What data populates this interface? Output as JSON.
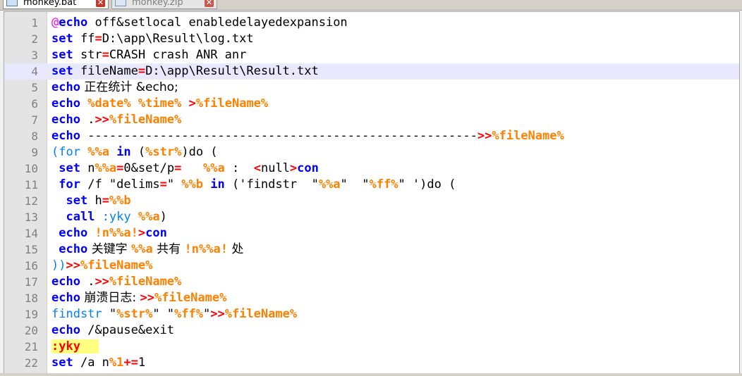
{
  "tabs": [
    {
      "label": "monkey.bat",
      "active": true
    },
    {
      "label": "monkey.zip",
      "active": false
    }
  ],
  "editor": {
    "current_line": 4,
    "lines": [
      {
        "n": "1",
        "tokens": [
          {
            "t": "@",
            "c": "at"
          },
          {
            "t": "echo",
            "c": "kw"
          },
          {
            "t": " off&setlocal enabledelayedexpansion",
            "c": "txt"
          }
        ]
      },
      {
        "n": "2",
        "tokens": [
          {
            "t": "set",
            "c": "kw"
          },
          {
            "t": " ff",
            "c": "txt"
          },
          {
            "t": "=",
            "c": "op"
          },
          {
            "t": "D:\\app\\Result\\log.txt",
            "c": "txt"
          }
        ]
      },
      {
        "n": "3",
        "tokens": [
          {
            "t": "set",
            "c": "kw"
          },
          {
            "t": " str",
            "c": "txt"
          },
          {
            "t": "=",
            "c": "op"
          },
          {
            "t": "CRASH crash ANR anr",
            "c": "txt"
          }
        ]
      },
      {
        "n": "4",
        "tokens": [
          {
            "t": "set",
            "c": "kw"
          },
          {
            "t": " fileName",
            "c": "txt"
          },
          {
            "t": "=",
            "c": "op"
          },
          {
            "t": "D:\\app\\Result\\Result.txt",
            "c": "txt"
          }
        ]
      },
      {
        "n": "5",
        "tokens": [
          {
            "t": "echo",
            "c": "kw"
          },
          {
            "t": " 正在统计 &echo;",
            "c": "txt"
          }
        ]
      },
      {
        "n": "6",
        "tokens": [
          {
            "t": "echo",
            "c": "kw"
          },
          {
            "t": " ",
            "c": "txt"
          },
          {
            "t": "%date%",
            "c": "var"
          },
          {
            "t": " ",
            "c": "txt"
          },
          {
            "t": "%time%",
            "c": "var"
          },
          {
            "t": " ",
            "c": "txt"
          },
          {
            "t": ">",
            "c": "op"
          },
          {
            "t": "%fileName%",
            "c": "var"
          }
        ]
      },
      {
        "n": "7",
        "tokens": [
          {
            "t": "echo",
            "c": "kw"
          },
          {
            "t": " .",
            "c": "txt"
          },
          {
            "t": ">>",
            "c": "op"
          },
          {
            "t": "%fileName%",
            "c": "var"
          }
        ]
      },
      {
        "n": "8",
        "tokens": [
          {
            "t": "echo",
            "c": "kw"
          },
          {
            "t": " ------------------------------------------------------",
            "c": "txt"
          },
          {
            "t": ">>",
            "c": "op"
          },
          {
            "t": "%fileName%",
            "c": "var"
          }
        ]
      },
      {
        "n": "9",
        "tokens": [
          {
            "t": "(",
            "c": "ext"
          },
          {
            "t": "for",
            "c": "ext"
          },
          {
            "t": " ",
            "c": "txt"
          },
          {
            "t": "%%a",
            "c": "var"
          },
          {
            "t": " ",
            "c": "txt"
          },
          {
            "t": "in",
            "c": "kw"
          },
          {
            "t": " (",
            "c": "txt"
          },
          {
            "t": "%str%",
            "c": "var"
          },
          {
            "t": ")do (",
            "c": "txt"
          }
        ]
      },
      {
        "n": "10",
        "tokens": [
          {
            "t": " ",
            "c": "txt"
          },
          {
            "t": "set",
            "c": "kw"
          },
          {
            "t": " n",
            "c": "txt"
          },
          {
            "t": "%%a",
            "c": "var"
          },
          {
            "t": "=",
            "c": "op"
          },
          {
            "t": "0&set/p",
            "c": "txt"
          },
          {
            "t": "=",
            "c": "op"
          },
          {
            "t": "   ",
            "c": "txt"
          },
          {
            "t": "%%a",
            "c": "var"
          },
          {
            "t": " :  ",
            "c": "txt"
          },
          {
            "t": "<",
            "c": "op"
          },
          {
            "t": "null",
            "c": "txt"
          },
          {
            "t": ">",
            "c": "op"
          },
          {
            "t": "con",
            "c": "kw"
          }
        ]
      },
      {
        "n": "11",
        "tokens": [
          {
            "t": " ",
            "c": "txt"
          },
          {
            "t": "for",
            "c": "kw"
          },
          {
            "t": " /f \"delims",
            "c": "txt"
          },
          {
            "t": "=",
            "c": "op"
          },
          {
            "t": "\" ",
            "c": "txt"
          },
          {
            "t": "%%b",
            "c": "var"
          },
          {
            "t": " ",
            "c": "txt"
          },
          {
            "t": "in",
            "c": "kw"
          },
          {
            "t": " ('findstr  \"",
            "c": "txt"
          },
          {
            "t": "%%a",
            "c": "var"
          },
          {
            "t": "\"  \"",
            "c": "txt"
          },
          {
            "t": "%ff%",
            "c": "var"
          },
          {
            "t": "\" ')do (",
            "c": "txt"
          }
        ]
      },
      {
        "n": "12",
        "tokens": [
          {
            "t": "  ",
            "c": "txt"
          },
          {
            "t": "set",
            "c": "kw"
          },
          {
            "t": " h",
            "c": "txt"
          },
          {
            "t": "=",
            "c": "op"
          },
          {
            "t": "%%b",
            "c": "var"
          }
        ]
      },
      {
        "n": "13",
        "tokens": [
          {
            "t": "  ",
            "c": "txt"
          },
          {
            "t": "call",
            "c": "kw"
          },
          {
            "t": " ",
            "c": "txt"
          },
          {
            "t": ":yky",
            "c": "ext"
          },
          {
            "t": " ",
            "c": "txt"
          },
          {
            "t": "%%a",
            "c": "var"
          },
          {
            "t": ")",
            "c": "txt"
          }
        ]
      },
      {
        "n": "14",
        "tokens": [
          {
            "t": " ",
            "c": "txt"
          },
          {
            "t": "echo",
            "c": "kw"
          },
          {
            "t": " ",
            "c": "txt"
          },
          {
            "t": "!n",
            "c": "var"
          },
          {
            "t": "%%a",
            "c": "var"
          },
          {
            "t": "!",
            "c": "var"
          },
          {
            "t": ">",
            "c": "op"
          },
          {
            "t": "con",
            "c": "kw"
          }
        ]
      },
      {
        "n": "15",
        "tokens": [
          {
            "t": " ",
            "c": "txt"
          },
          {
            "t": "echo",
            "c": "kw"
          },
          {
            "t": " 关键字 ",
            "c": "txt"
          },
          {
            "t": "%%a",
            "c": "var"
          },
          {
            "t": " 共有 ",
            "c": "txt"
          },
          {
            "t": "!n",
            "c": "var"
          },
          {
            "t": "%%a",
            "c": "var"
          },
          {
            "t": "!",
            "c": "var"
          },
          {
            "t": " 处",
            "c": "txt"
          }
        ]
      },
      {
        "n": "16",
        "tokens": [
          {
            "t": "))",
            "c": "ext"
          },
          {
            "t": ">>",
            "c": "op"
          },
          {
            "t": "%fileName%",
            "c": "var"
          }
        ]
      },
      {
        "n": "17",
        "tokens": [
          {
            "t": "echo",
            "c": "kw"
          },
          {
            "t": " .",
            "c": "txt"
          },
          {
            "t": ">>",
            "c": "op"
          },
          {
            "t": "%fileName%",
            "c": "var"
          }
        ]
      },
      {
        "n": "18",
        "tokens": [
          {
            "t": "echo",
            "c": "kw"
          },
          {
            "t": " 崩溃日志: ",
            "c": "txt"
          },
          {
            "t": ">>",
            "c": "op"
          },
          {
            "t": "%fileName%",
            "c": "var"
          }
        ]
      },
      {
        "n": "19",
        "tokens": [
          {
            "t": "findstr",
            "c": "ext"
          },
          {
            "t": " \"",
            "c": "txt"
          },
          {
            "t": "%str%",
            "c": "var"
          },
          {
            "t": "\" \"",
            "c": "txt"
          },
          {
            "t": "%ff%",
            "c": "var"
          },
          {
            "t": "\"",
            "c": "txt"
          },
          {
            "t": ">>",
            "c": "op"
          },
          {
            "t": "%fileName%",
            "c": "var"
          }
        ]
      },
      {
        "n": "20",
        "tokens": [
          {
            "t": "echo",
            "c": "kw"
          },
          {
            "t": " /&pause&exit",
            "c": "txt"
          }
        ]
      },
      {
        "n": "21",
        "tokens": [
          {
            "t": ":yky",
            "c": "lbl"
          }
        ]
      },
      {
        "n": "22",
        "tokens": [
          {
            "t": "set",
            "c": "kw"
          },
          {
            "t": " /a n",
            "c": "txt"
          },
          {
            "t": "%1",
            "c": "var"
          },
          {
            "t": "+=",
            "c": "op"
          },
          {
            "t": "1",
            "c": "txt"
          }
        ]
      }
    ]
  }
}
